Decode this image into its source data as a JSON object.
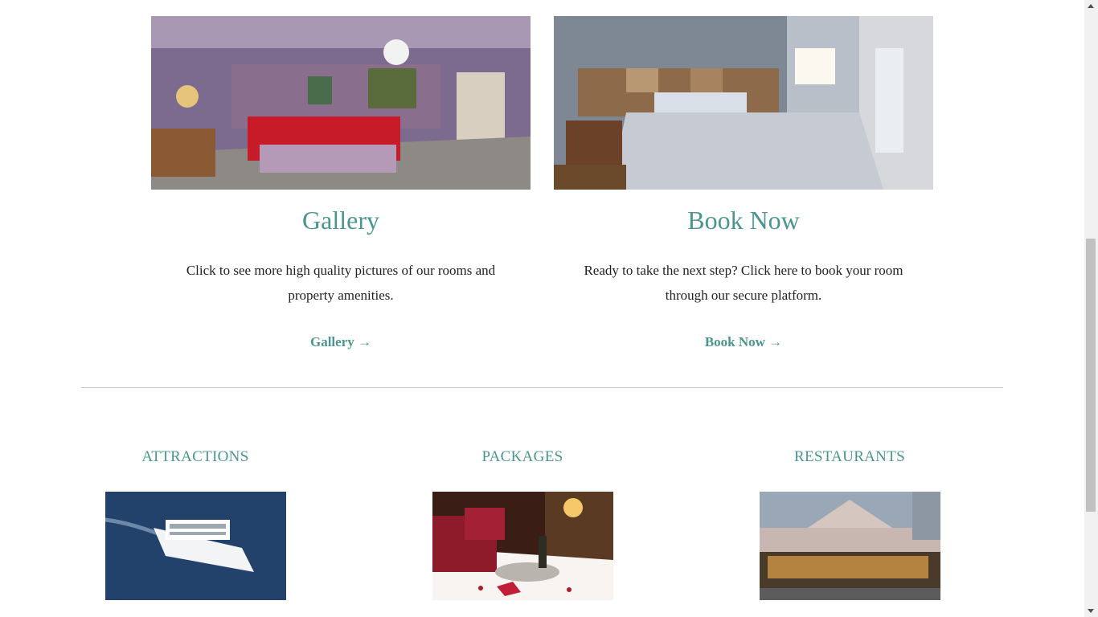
{
  "cards": [
    {
      "image": "jacuzzi-suite-photo",
      "title": "Gallery",
      "text": "Click to see more high quality pictures of our rooms and property amenities.",
      "link": "Gallery →"
    },
    {
      "image": "king-bedroom-photo",
      "title": "Book Now",
      "text": "Ready to take the next step? Click here to book your room through our secure platform.",
      "link": "Book Now →"
    }
  ],
  "categories": [
    {
      "title": "ATTRACTIONS",
      "image": "cruise-ship-photo"
    },
    {
      "title": "PACKAGES",
      "image": "romance-package-photo"
    },
    {
      "title": "RESTAURANTS",
      "image": "restaurant-exterior-photo"
    }
  ],
  "colors": {
    "accent": "#4a968f",
    "divider": "#c8c8c8",
    "text": "#222222"
  }
}
